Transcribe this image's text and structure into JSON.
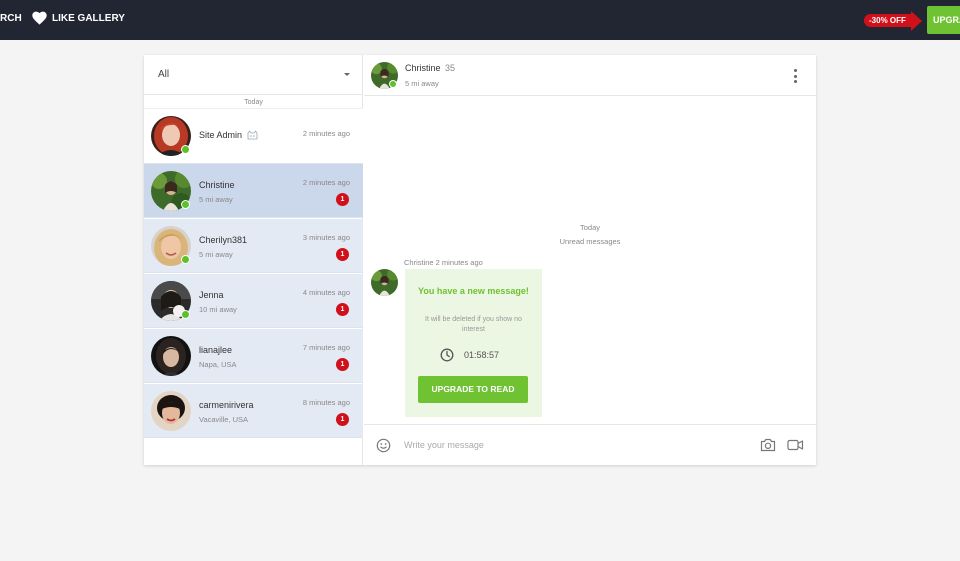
{
  "nav": {
    "search_label": "RCH",
    "like_gallery_label": "LIKE GALLERY",
    "discount_label": "-30% OFF",
    "upgrade_label": "UPGRA"
  },
  "sidebar": {
    "filter": {
      "selected": "All"
    },
    "day_separator": "Today",
    "conversations": [
      {
        "name": "Site Admin",
        "time": "2 minutes ago",
        "subtitle": "",
        "online": true,
        "unread": "",
        "has_badge_icon": true
      },
      {
        "name": "Christine",
        "time": "2 minutes ago",
        "subtitle": "5 mi away",
        "online": true,
        "unread": "1"
      },
      {
        "name": "Cherilyn381",
        "time": "3 minutes ago",
        "subtitle": "5 mi away",
        "online": true,
        "unread": "1"
      },
      {
        "name": "Jenna",
        "time": "4 minutes ago",
        "subtitle": "10 mi away",
        "online": true,
        "unread": "1"
      },
      {
        "name": "lianajlee",
        "time": "7 minutes ago",
        "subtitle": "Napa, USA",
        "online": false,
        "unread": "1"
      },
      {
        "name": "carmenirivera",
        "time": "8 minutes ago",
        "subtitle": "Vacaville, USA",
        "online": false,
        "unread": "1"
      }
    ]
  },
  "chat": {
    "header": {
      "name": "Christine",
      "age": "35",
      "distance": "5 mi away"
    },
    "day_label": "Today",
    "unread_label": "Unread messages",
    "message": {
      "meta": "Christine 2 minutes ago",
      "title": "You have a new message!",
      "note": "It will be deleted if you show no interest",
      "timer": "01:58:57",
      "button": "UPGRADE TO READ"
    },
    "composer": {
      "placeholder": "Write your message",
      "value": ""
    }
  },
  "colors": {
    "nav_bg": "#222632",
    "accent_green": "#6fc231",
    "badge_red": "#d0111b",
    "active_row": "#cbd7ea",
    "unread_row": "#e4eaf4",
    "online": "#5ec02b"
  },
  "icons": [
    "heart-icon",
    "kebab-menu-icon",
    "clock-icon",
    "smile-icon",
    "camera-icon",
    "video-icon",
    "admin-badge-icon"
  ]
}
